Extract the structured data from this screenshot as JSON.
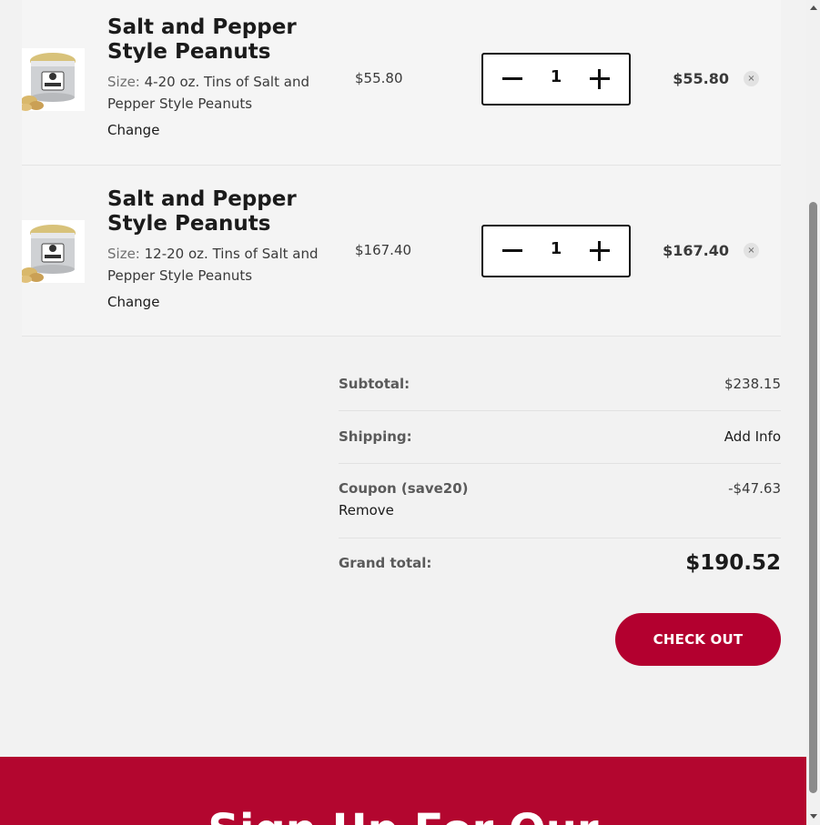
{
  "cart": {
    "items": [
      {
        "name": "Salt and Pepper Style Peanuts",
        "size_label": "Size:",
        "size_value": "4-20 oz. Tins of Salt and Pepper Style Peanuts",
        "change_label": "Change",
        "unit_price": "$55.80",
        "quantity": "1",
        "line_total": "$55.80",
        "remove_symbol": "×",
        "thumb_icon": "peanut-tin-image"
      },
      {
        "name": "Salt and Pepper Style Peanuts",
        "size_label": "Size:",
        "size_value": "12-20 oz. Tins of Salt and Pepper Style Peanuts",
        "change_label": "Change",
        "unit_price": "$167.40",
        "quantity": "1",
        "line_total": "$167.40",
        "remove_symbol": "×",
        "thumb_icon": "peanut-tin-image"
      }
    ]
  },
  "summary": {
    "subtotal_label": "Subtotal:",
    "subtotal_value": "$238.15",
    "shipping_label": "Shipping:",
    "shipping_value": "Add Info",
    "coupon_label": "Coupon (save20)",
    "coupon_value": "-$47.63",
    "coupon_remove": "Remove",
    "grand_total_label": "Grand total:",
    "grand_total_value": "$190.52"
  },
  "checkout": {
    "label": "CHECK OUT"
  },
  "footer": {
    "heading": "Sign Up For Our"
  },
  "colors": {
    "brand_red": "#b3002f",
    "page_bg": "#f2f2f2",
    "text": "#1b1b1b"
  },
  "icons": {
    "quantity_decrease": "minus-icon",
    "quantity_increase": "plus-icon",
    "remove": "close-icon"
  }
}
